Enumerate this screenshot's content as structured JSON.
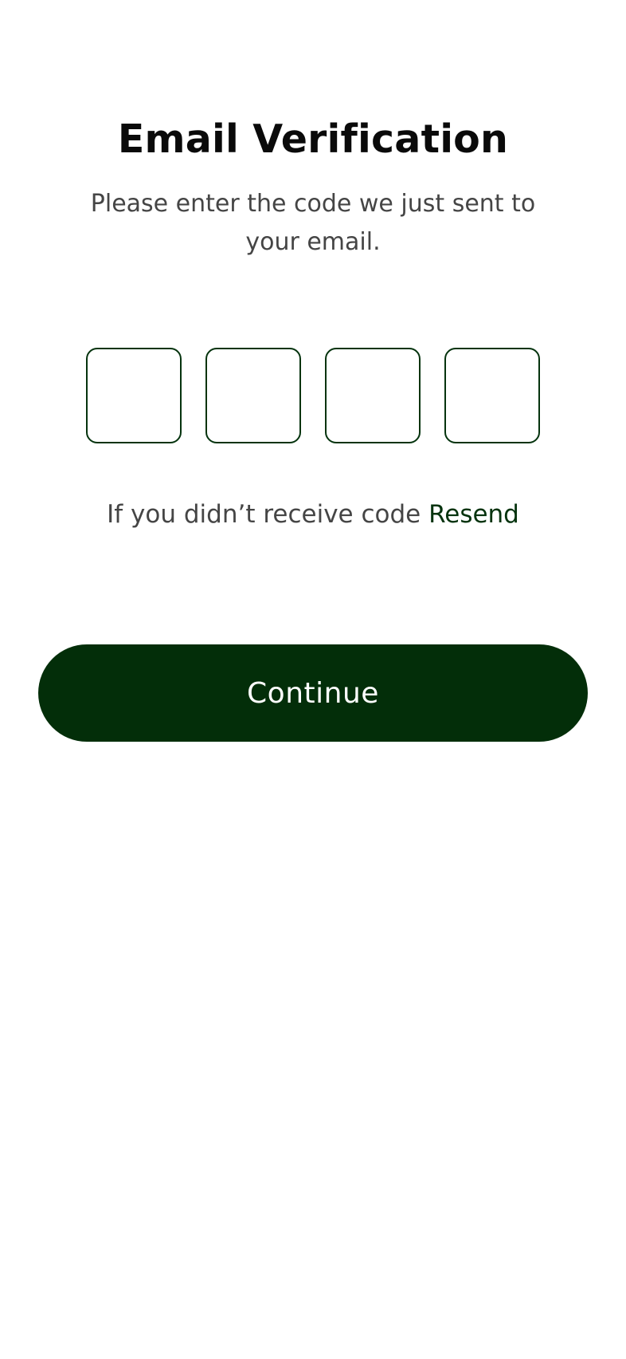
{
  "screen": {
    "title": "Email Verification",
    "subtitle": "Please enter the code we just sent to your email."
  },
  "otp": {
    "digits": [
      "",
      "",
      "",
      ""
    ]
  },
  "resend": {
    "prompt": "If you didn’t receive code",
    "link_label": "Resend"
  },
  "actions": {
    "continue_label": "Continue"
  },
  "colors": {
    "accent": "#032e09",
    "box_border": "#05330e",
    "title": "#0a0a0a",
    "body_text": "#454545",
    "background": "#ffffff"
  }
}
